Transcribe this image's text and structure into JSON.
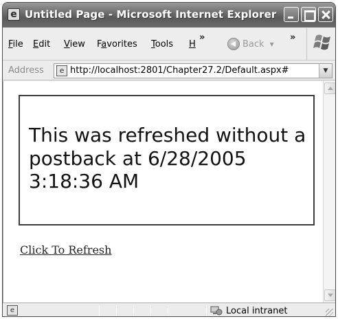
{
  "window": {
    "title": "Untitled Page - Microsoft Internet Explorer",
    "title_icon": "ie-page-icon"
  },
  "menubar": {
    "items": [
      {
        "label": "File",
        "accel": "F",
        "rest": "ile"
      },
      {
        "label": "Edit",
        "accel": "E",
        "rest": "dit"
      },
      {
        "label": "View",
        "accel": "V",
        "rest": "iew"
      },
      {
        "label": "Favorites",
        "pre": "F",
        "accel": "a",
        "rest": "vorites"
      },
      {
        "label": "Tools",
        "accel": "T",
        "rest": "ools"
      },
      {
        "label": "H",
        "accel": "H",
        "rest": ""
      }
    ],
    "chevron": "»",
    "back_label": "Back"
  },
  "address": {
    "label": "Address",
    "url": "http://localhost:2801/Chapter27.2/Default.aspx#"
  },
  "content": {
    "panel_text": "This was refreshed without a postback at 6/28/2005 3:18:36 AM",
    "link_text": "Click To Refresh"
  },
  "status": {
    "zone": "Local intranet"
  }
}
